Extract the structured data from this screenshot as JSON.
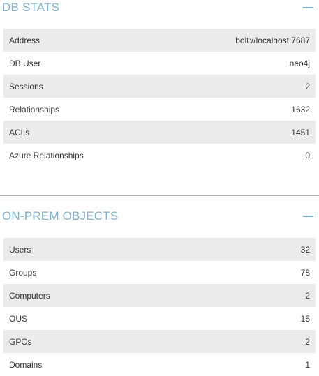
{
  "db_stats": {
    "title": "DB STATS",
    "collapse_icon": "minus-icon",
    "rows": [
      {
        "label": "Address",
        "value": "bolt://localhost:7687"
      },
      {
        "label": "DB User",
        "value": "neo4j"
      },
      {
        "label": "Sessions",
        "value": "2"
      },
      {
        "label": "Relationships",
        "value": "1632"
      },
      {
        "label": "ACLs",
        "value": "1451"
      },
      {
        "label": "Azure Relationships",
        "value": "0"
      }
    ]
  },
  "on_prem": {
    "title": "ON-PREM OBJECTS",
    "collapse_icon": "minus-icon",
    "rows": [
      {
        "label": "Users",
        "value": "32"
      },
      {
        "label": "Groups",
        "value": "78"
      },
      {
        "label": "Computers",
        "value": "2"
      },
      {
        "label": "OUS",
        "value": "15"
      },
      {
        "label": "GPOs",
        "value": "2"
      },
      {
        "label": "Domains",
        "value": "1"
      }
    ]
  },
  "colors": {
    "accent": "#7fb1c9",
    "row_stripe": "#ebebeb",
    "text": "#333333"
  }
}
